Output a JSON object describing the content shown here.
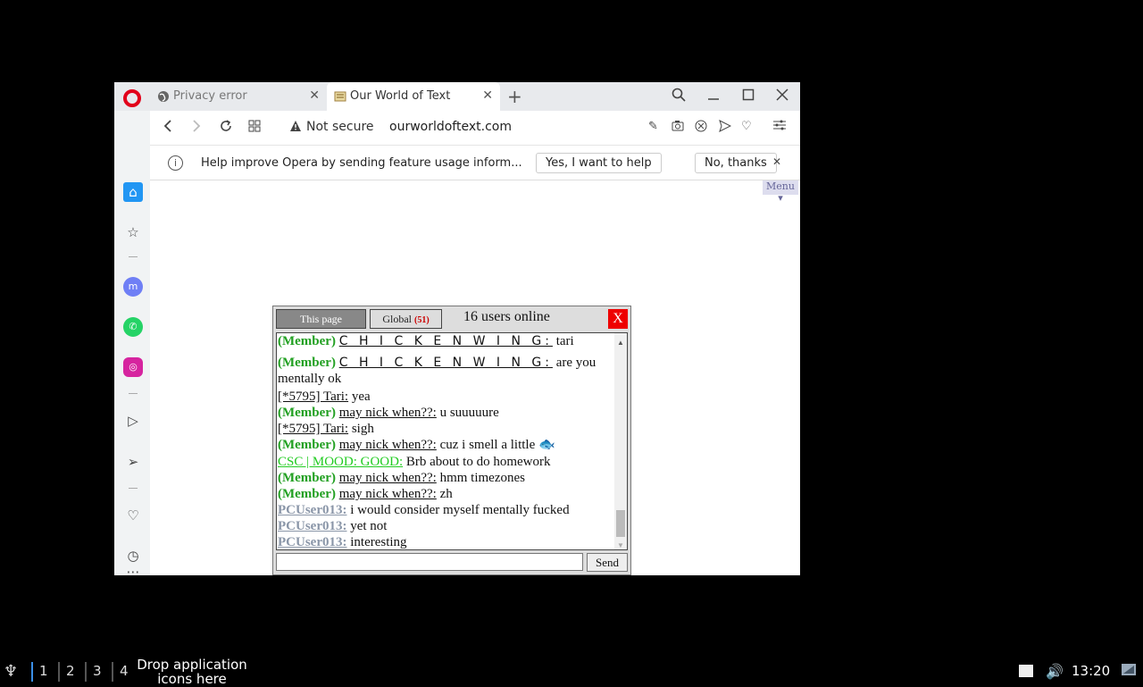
{
  "browser": {
    "tabs": [
      {
        "label": "Privacy error",
        "favicon": "globe-icon"
      },
      {
        "label": "Our World of Text",
        "favicon": "owot-icon"
      }
    ],
    "address": {
      "security": "Not secure",
      "url": "ourworldoftext.com"
    },
    "infobar": {
      "text": "Help improve Opera by sending feature usage inform...",
      "accept": "Yes, I want to help",
      "decline": "No, thanks"
    },
    "sidebar": [
      "home-icon",
      "star-icon",
      "messenger-icon",
      "whatsapp-icon",
      "instagram-icon",
      "player-icon",
      "send-icon",
      "heart-icon",
      "history-icon",
      "more-icon"
    ]
  },
  "page": {
    "menu_label": "Menu",
    "chat": {
      "tab_page": "This page",
      "tab_global": "Global",
      "global_count": "(51)",
      "online": "16 users online",
      "close": "X",
      "send": "Send",
      "messages": [
        {
          "tag": "(Member)",
          "user": "C H I C K E N   W I N G:",
          "style": "wide",
          "text": " tari"
        },
        {
          "tag": "(Member)",
          "user": "C H I C K E N   W I N G:",
          "style": "wide",
          "text": " are you mentally ok"
        },
        {
          "tag": "",
          "user": "[*5795] Tari:",
          "style": "plain",
          "text": " yea"
        },
        {
          "tag": "(Member)",
          "user": "may nick when??:",
          "style": "plain",
          "text": " u suuuuure"
        },
        {
          "tag": "",
          "user": "[*5795] Tari:",
          "style": "plain",
          "text": " sigh"
        },
        {
          "tag": "(Member)",
          "user": "may nick when??:",
          "style": "plain",
          "text": " cuz i smell a little 🐟"
        },
        {
          "tag": "",
          "user": "CSC | MOOD: GOOD:",
          "style": "green",
          "text": " Brb about to do homework"
        },
        {
          "tag": "(Member)",
          "user": "may nick when??:",
          "style": "plain",
          "text": " hmm timezones"
        },
        {
          "tag": "(Member)",
          "user": "may nick when??:",
          "style": "plain",
          "text": " zh"
        },
        {
          "tag": "",
          "user": "PCUser013:",
          "style": "gray",
          "text": " i would consider myself mentally fucked"
        },
        {
          "tag": "",
          "user": "PCUser013:",
          "style": "gray",
          "text": " yet not"
        },
        {
          "tag": "",
          "user": "PCUser013:",
          "style": "gray",
          "text": " interesting"
        }
      ]
    }
  },
  "taskbar": {
    "workspaces": [
      "1",
      "2",
      "3",
      "4"
    ],
    "drop_text": "Drop application icons here",
    "clock": "13:20"
  }
}
